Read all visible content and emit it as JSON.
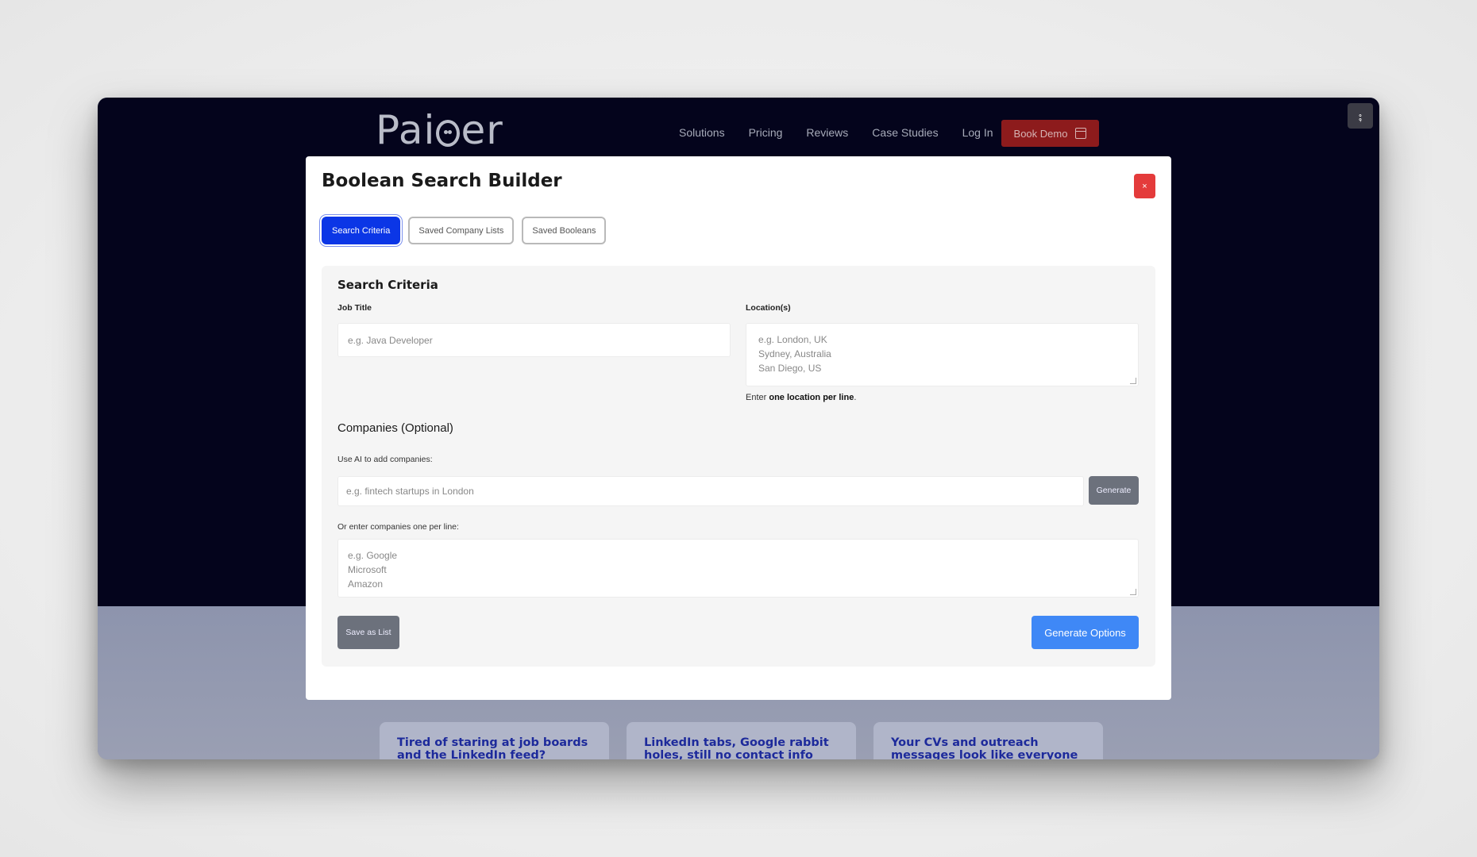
{
  "site": {
    "logo": "Paiger",
    "nav": [
      "Solutions",
      "Pricing",
      "Reviews",
      "Case Studies",
      "Log In"
    ],
    "book_demo": "Book Demo",
    "cards": [
      "Tired of staring at job boards and the LinkedIn feed?",
      "LinkedIn tabs, Google rabbit holes, still no contact info",
      "Your CVs and outreach messages look like everyone else's"
    ]
  },
  "modal": {
    "title": "Boolean Search Builder",
    "close": "×",
    "tabs": [
      "Search Criteria",
      "Saved Company Lists",
      "Saved Booleans"
    ],
    "active_tab": "Search Criteria",
    "section_title": "Search Criteria",
    "job_title": {
      "label": "Job Title",
      "placeholder": "e.g. Java Developer"
    },
    "locations": {
      "label": "Location(s)",
      "placeholder_lines": [
        "e.g. London, UK",
        "Sydney, Australia",
        "San Diego, US"
      ],
      "hint_prefix": "Enter ",
      "hint_bold": "one location per line",
      "hint_suffix": "."
    },
    "companies": {
      "title": "Companies (Optional)",
      "ai_label": "Use AI to add companies:",
      "ai_placeholder": "e.g. fintech startups in London",
      "generate": "Generate",
      "manual_label": "Or enter companies one per line:",
      "placeholder_lines": [
        "e.g. Google",
        "Microsoft",
        "Amazon"
      ]
    },
    "save_as_list": "Save as List",
    "generate_options": "Generate Options"
  },
  "colors": {
    "primary_tab": "#0b36e6",
    "close": "#e43b3b",
    "generate_options": "#3f88f6",
    "book_demo": "#8d1b1c"
  }
}
